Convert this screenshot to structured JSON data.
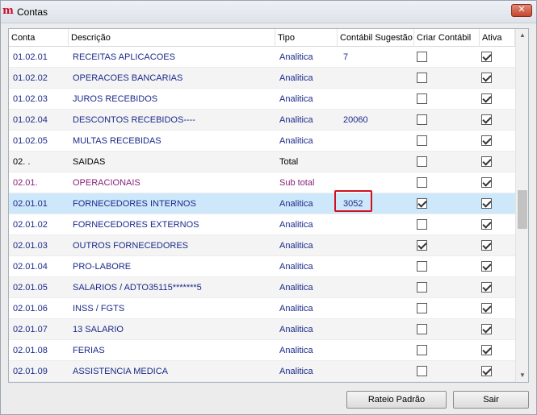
{
  "window": {
    "title": "Contas",
    "close_label": "✕"
  },
  "app_icon_glyph": "m",
  "columns": {
    "conta": "Conta",
    "descricao": "Descrição",
    "tipo": "Tipo",
    "contabil": "Contábil Sugestão",
    "criar": "Criar Contábil",
    "ativa": "Ativa"
  },
  "rows": [
    {
      "conta": "01.02.01",
      "descricao": "RECEITAS APLICACOES",
      "tipo": "Analitica",
      "contabil": "7",
      "criar": false,
      "ativa": true,
      "style": "blue"
    },
    {
      "conta": "01.02.02",
      "descricao": "OPERACOES BANCARIAS",
      "tipo": "Analitica",
      "contabil": "",
      "criar": false,
      "ativa": true,
      "style": "blue"
    },
    {
      "conta": "01.02.03",
      "descricao": "JUROS RECEBIDOS",
      "tipo": "Analitica",
      "contabil": "",
      "criar": false,
      "ativa": true,
      "style": "blue"
    },
    {
      "conta": "01.02.04",
      "descricao": "DESCONTOS RECEBIDOS----",
      "tipo": "Analitica",
      "contabil": "20060",
      "criar": false,
      "ativa": true,
      "style": "blue"
    },
    {
      "conta": "01.02.05",
      "descricao": "MULTAS RECEBIDAS",
      "tipo": "Analitica",
      "contabil": "",
      "criar": false,
      "ativa": true,
      "style": "blue"
    },
    {
      "conta": "02.  .",
      "descricao": "SAIDAS",
      "tipo": "Total",
      "contabil": "",
      "criar": false,
      "ativa": true,
      "style": "black"
    },
    {
      "conta": "02.01.",
      "descricao": "OPERACIONAIS",
      "tipo": "Sub total",
      "contabil": "",
      "criar": false,
      "ativa": true,
      "style": "purple"
    },
    {
      "conta": "02.01.01",
      "descricao": "FORNECEDORES INTERNOS",
      "tipo": "Analitica",
      "contabil": "3052",
      "criar": true,
      "ativa": true,
      "style": "blue",
      "selected": true
    },
    {
      "conta": "02.01.02",
      "descricao": "FORNECEDORES EXTERNOS",
      "tipo": "Analitica",
      "contabil": "",
      "criar": false,
      "ativa": true,
      "style": "blue"
    },
    {
      "conta": "02.01.03",
      "descricao": "OUTROS FORNECEDORES",
      "tipo": "Analitica",
      "contabil": "",
      "criar": true,
      "ativa": true,
      "style": "blue"
    },
    {
      "conta": "02.01.04",
      "descricao": "PRO-LABORE",
      "tipo": "Analitica",
      "contabil": "",
      "criar": false,
      "ativa": true,
      "style": "blue"
    },
    {
      "conta": "02.01.05",
      "descricao": "SALARIOS / ADTO35115*******5",
      "tipo": "Analitica",
      "contabil": "",
      "criar": false,
      "ativa": true,
      "style": "blue"
    },
    {
      "conta": "02.01.06",
      "descricao": "INSS / FGTS",
      "tipo": "Analitica",
      "contabil": "",
      "criar": false,
      "ativa": true,
      "style": "blue"
    },
    {
      "conta": "02.01.07",
      "descricao": "13 SALARIO",
      "tipo": "Analitica",
      "contabil": "",
      "criar": false,
      "ativa": true,
      "style": "blue"
    },
    {
      "conta": "02.01.08",
      "descricao": "FERIAS",
      "tipo": "Analitica",
      "contabil": "",
      "criar": false,
      "ativa": true,
      "style": "blue"
    },
    {
      "conta": "02.01.09",
      "descricao": "ASSISTENCIA MEDICA",
      "tipo": "Analitica",
      "contabil": "",
      "criar": false,
      "ativa": true,
      "style": "blue"
    }
  ],
  "buttons": {
    "rateio": "Rateio Padrão",
    "sair": "Sair"
  },
  "scrollbar": {
    "up": "▲",
    "down": "▼"
  },
  "colors": {
    "selected_row": "#cde8fa",
    "highlight": "#d0101f",
    "blue_text": "#1b2a8a",
    "purple_text": "#8a1f7a"
  }
}
